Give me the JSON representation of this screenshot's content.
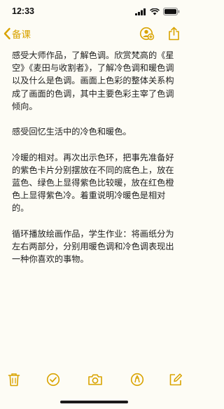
{
  "status": {
    "time": "12:33"
  },
  "nav": {
    "back_label": "备课"
  },
  "note": {
    "paragraphs": [
      "感受大师作品，了解色调。欣赏梵高的《星空》《麦田与收割者》，了解冷色调和暖色调以及什么是色调。画面上色彩的整体关系构成了画面的色调，其中主要色彩主宰了色调倾向。",
      "感受回忆生活中的冷色和暖色。",
      "冷暖的相对。再次出示色环，把事先准备好的紫色卡片分别摆放在不同的底色上，放在蓝色、绿色上显得紫色比较暖，放在红色橙色上显得紫色冷。着重说明冷暖色是相对的。",
      "循环播放绘画作品，学生作业：将画纸分为左右两部分，分别用暖色调和冷色调表现出一种你喜欢的事物。"
    ]
  },
  "theme": {
    "accent": "#d9a300",
    "background": "#fdfcf5"
  },
  "icons": {
    "status": [
      "cellular-signal-icon",
      "wifi-icon",
      "battery-icon"
    ],
    "nav": [
      "chevron-left-icon",
      "add-person-icon",
      "share-icon"
    ],
    "toolbar": [
      "trash-icon",
      "checklist-icon",
      "camera-icon",
      "markup-icon",
      "compose-icon"
    ]
  }
}
